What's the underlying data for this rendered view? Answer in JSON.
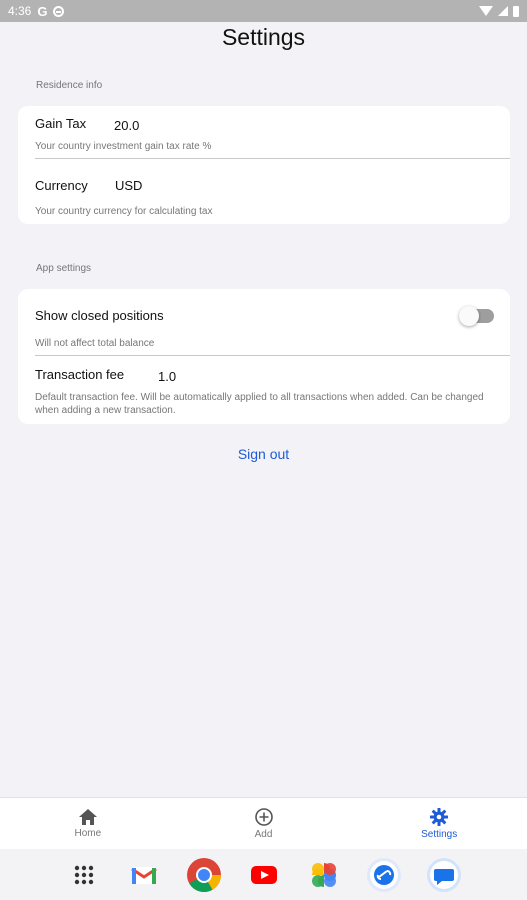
{
  "status_bar": {
    "time": "4:36",
    "g_label": "G"
  },
  "page": {
    "title": "Settings"
  },
  "residence": {
    "section_label": "Residence info",
    "gain_tax": {
      "label": "Gain Tax",
      "value": "20.0",
      "description": "Your country investment gain tax rate %"
    },
    "currency": {
      "label": "Currency",
      "value": "USD",
      "description": "Your country currency for calculating tax"
    }
  },
  "app_settings": {
    "section_label": "App settings",
    "show_closed": {
      "label": "Show closed positions",
      "description": "Will not affect total balance",
      "enabled": false
    },
    "transaction_fee": {
      "label": "Transaction fee",
      "value": "1.0",
      "description": "Default transaction fee. Will be automatically applied to all transactions when added. Can be changed when adding a new transaction."
    }
  },
  "sign_out_label": "Sign out",
  "bottom_nav": {
    "items": [
      {
        "label": "Home",
        "icon": "home-icon",
        "active": false
      },
      {
        "label": "Add",
        "icon": "add-circle-icon",
        "active": false
      },
      {
        "label": "Settings",
        "icon": "gear-icon",
        "active": true
      }
    ]
  },
  "dock": {
    "apps": [
      "app-drawer-icon",
      "gmail-icon",
      "chrome-icon",
      "youtube-icon",
      "photos-icon",
      "link-app-icon",
      "messages-icon"
    ]
  },
  "colors": {
    "accent": "#1e5bd6",
    "background": "#f2f2f7",
    "card": "#ffffff"
  }
}
